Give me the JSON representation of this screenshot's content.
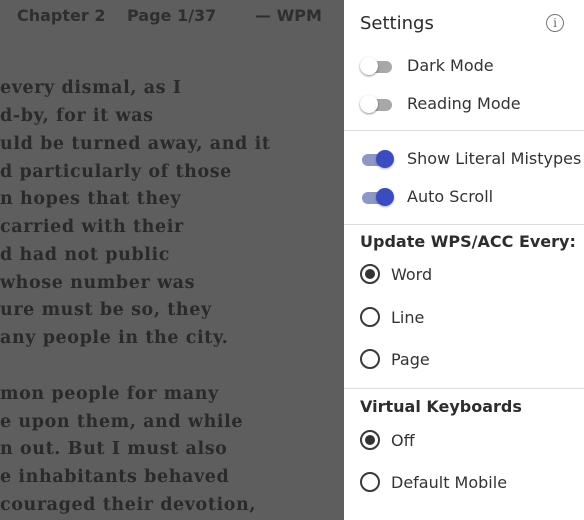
{
  "reader": {
    "chapter": "Chapter 2",
    "page": "Page 1/37",
    "wpm": "— WPM",
    "lines": [
      "every dismal, as I",
      "d-by, for it was",
      "uld be turned away, and it",
      "d particularly of those",
      "n hopes that they",
      "carried with their",
      "d had not public",
      "whose number was",
      "ure must be so, they",
      "any people in the city.",
      "",
      "mon people for many",
      "e upon them, and while",
      "n out. But I must also",
      "e inhabitants behaved",
      "couraged their devotion,"
    ]
  },
  "settings": {
    "title": "Settings",
    "info_icon": "info-icon",
    "toggles": [
      {
        "label": "Dark Mode",
        "on": false
      },
      {
        "label": "Reading Mode",
        "on": false
      },
      {
        "label": "Show Literal Mistypes",
        "on": true
      },
      {
        "label": "Auto Scroll",
        "on": true
      }
    ],
    "update_section": {
      "title": "Update WPS/ACC Every:",
      "options": [
        {
          "label": "Word",
          "selected": true
        },
        {
          "label": "Line",
          "selected": false
        },
        {
          "label": "Page",
          "selected": false
        }
      ]
    },
    "keyboard_section": {
      "title": "Virtual Keyboards",
      "options": [
        {
          "label": "Off",
          "selected": true
        },
        {
          "label": "Default Mobile",
          "selected": false
        }
      ]
    }
  },
  "colors": {
    "toggle_on": "#3b4cc0",
    "overlay": "#5e5e5e"
  }
}
